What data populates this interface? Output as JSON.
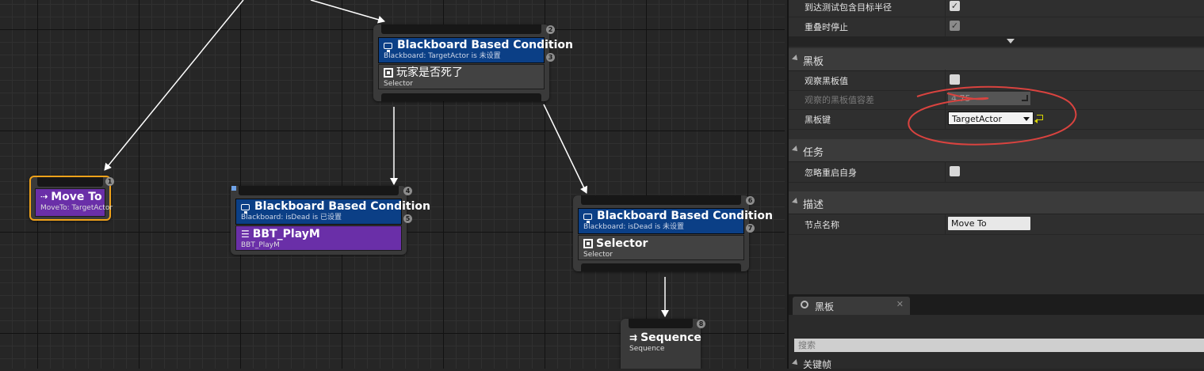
{
  "graph": {
    "nodes": [
      {
        "id": "n1",
        "badge": "1",
        "task_title": "Move To",
        "task_sub": "MoveTo: TargetActor",
        "color": "#6a2fa8",
        "selected": true
      },
      {
        "id": "n2",
        "badge_deco": "2",
        "badge_body": "3",
        "deco_title": "Blackboard Based Condition",
        "deco_sub": "Blackboard: TargetActor is 未设置",
        "body_title": "玩家是否死了",
        "body_sub": "Selector",
        "body_icon": "selector-icon"
      },
      {
        "id": "n3",
        "badge_deco": "4",
        "badge_body": "5",
        "deco_title": "Blackboard Based Condition",
        "deco_sub": "Blackboard: isDead is 已设置",
        "body_title": "BBT_PlayM",
        "body_sub": "BBT_PlayM",
        "body_icon": "task-icon"
      },
      {
        "id": "n4",
        "badge_deco": "6",
        "badge_body": "7",
        "deco_title": "Blackboard Based Condition",
        "deco_sub": "Blackboard: isDead is 未设置",
        "body_title": "Selector",
        "body_sub": "Selector",
        "body_icon": "selector-icon"
      },
      {
        "id": "n5",
        "badge": "8",
        "body_title": "Sequence",
        "body_sub": "Sequence",
        "body_icon": "sequence-icon"
      }
    ]
  },
  "details": {
    "rows": {
      "arrive_test": {
        "label": "到达测试包含目标半径",
        "checked": true
      },
      "stop_on_overlap": {
        "label": "重叠时停止",
        "checked": true
      },
      "cat_blackboard": {
        "label": "黑板"
      },
      "observe_value": {
        "label": "观察黑板值",
        "checked": false
      },
      "observed_tolerance": {
        "label": "观察的黑板值容差",
        "value": "4.75"
      },
      "blackboard_key": {
        "label": "黑板键",
        "value": "TargetActor"
      },
      "cat_task": {
        "label": "任务"
      },
      "ignore_restart": {
        "label": "忽略重启自身",
        "checked": false
      },
      "cat_description": {
        "label": "描述"
      },
      "node_name": {
        "label": "节点名称",
        "value": "Move To"
      }
    },
    "annotation_color": "#d9433f"
  },
  "blackboard_panel": {
    "tab_label": "黑板",
    "tab_close": "✕",
    "search_placeholder": "搜索",
    "section_label": "关键帧"
  }
}
